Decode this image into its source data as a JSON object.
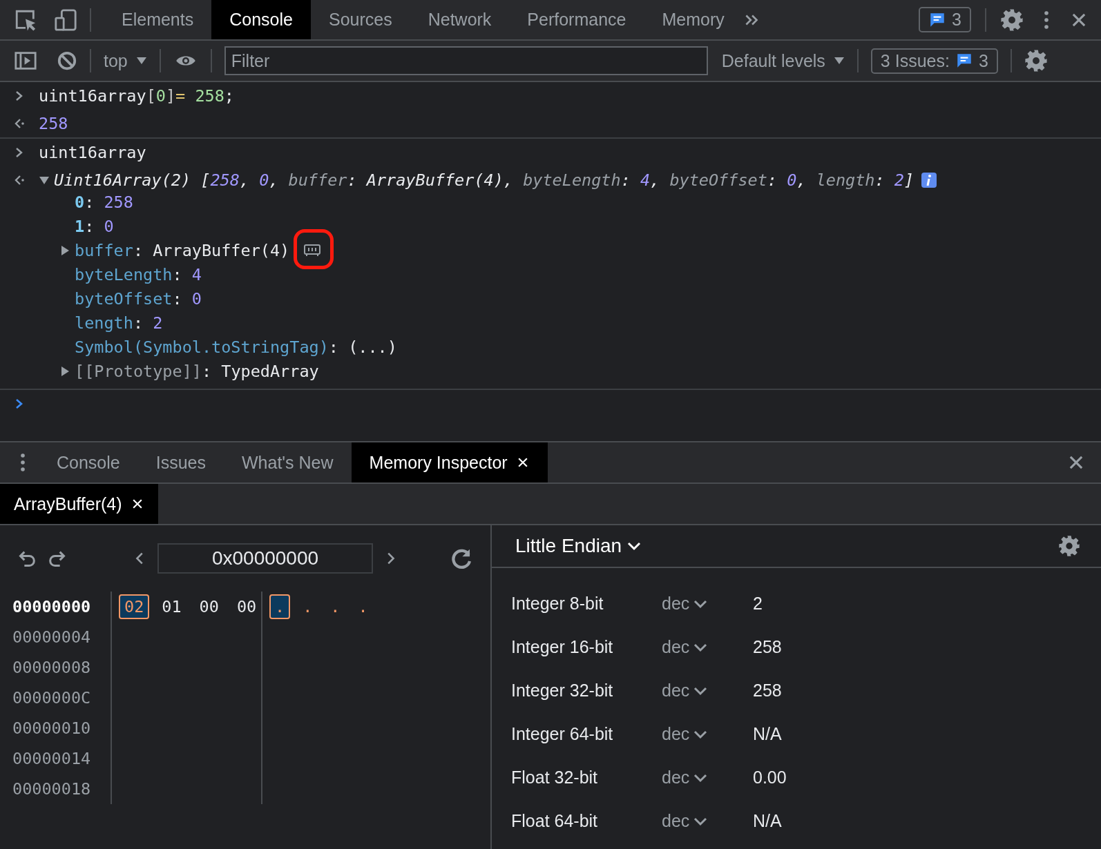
{
  "main_tabs": [
    {
      "label": "Elements",
      "selected": false
    },
    {
      "label": "Console",
      "selected": true
    },
    {
      "label": "Sources",
      "selected": false
    },
    {
      "label": "Network",
      "selected": false
    },
    {
      "label": "Performance",
      "selected": false
    },
    {
      "label": "Memory",
      "selected": false
    }
  ],
  "issues_badge": "3",
  "console_toolbar": {
    "context": "top",
    "filter_placeholder": "Filter",
    "levels": "Default levels",
    "issues_label": "3 Issues:",
    "issues_count": "3"
  },
  "console_entries": [
    {
      "kind": "input",
      "tokens": [
        {
          "text": "uint16array",
          "kind": "plain"
        },
        {
          "text": "[",
          "kind": "punct"
        },
        {
          "text": "0",
          "kind": "literal"
        },
        {
          "text": "]",
          "kind": "punct"
        },
        {
          "text": "=",
          "kind": "operator"
        },
        {
          "text": " 258",
          "kind": "literal"
        },
        {
          "text": ";",
          "kind": "plain"
        }
      ]
    },
    {
      "kind": "result",
      "tokens": [
        {
          "text": "258",
          "kind": "number"
        }
      ]
    },
    {
      "kind": "input",
      "tokens": [
        {
          "text": "uint16array",
          "kind": "plain"
        }
      ]
    },
    {
      "kind": "object",
      "expanded": true,
      "tokens": [
        {
          "text": "Uint16Array(2) [",
          "kind": "plain"
        },
        {
          "text": "258",
          "kind": "number"
        },
        {
          "text": ", ",
          "kind": "plain"
        },
        {
          "text": "0",
          "kind": "number"
        },
        {
          "text": ", ",
          "kind": "plain"
        },
        {
          "text": "buffer",
          "kind": "preview_key"
        },
        {
          "text": ": ArrayBuffer(4), ",
          "kind": "plain"
        },
        {
          "text": "byteLength",
          "kind": "preview_key"
        },
        {
          "text": ": ",
          "kind": "plain"
        },
        {
          "text": "4",
          "kind": "number"
        },
        {
          "text": ", ",
          "kind": "plain"
        },
        {
          "text": "byteOffset",
          "kind": "preview_key"
        },
        {
          "text": ": ",
          "kind": "plain"
        },
        {
          "text": "0",
          "kind": "number"
        },
        {
          "text": ", ",
          "kind": "plain"
        },
        {
          "text": "length",
          "kind": "preview_key"
        },
        {
          "text": ": ",
          "kind": "plain"
        },
        {
          "text": "2",
          "kind": "number"
        },
        {
          "text": "]",
          "kind": "plain"
        }
      ],
      "children": [
        {
          "kind": "property",
          "tokens": [
            {
              "text": "0",
              "kind": "index"
            },
            {
              "text": ": ",
              "kind": "plain"
            },
            {
              "text": "258",
              "kind": "number"
            }
          ]
        },
        {
          "kind": "property",
          "tokens": [
            {
              "text": "1",
              "kind": "index"
            },
            {
              "text": ": ",
              "kind": "plain"
            },
            {
              "text": "0",
              "kind": "number"
            }
          ]
        },
        {
          "kind": "buffer",
          "expanded": false,
          "highlighted": true,
          "tokens": [
            {
              "text": "buffer",
              "kind": "key"
            },
            {
              "text": ": ArrayBuffer(4)",
              "kind": "plain"
            }
          ]
        },
        {
          "kind": "property",
          "tokens": [
            {
              "text": "byteLength",
              "kind": "key"
            },
            {
              "text": ": ",
              "kind": "plain"
            },
            {
              "text": "4",
              "kind": "number"
            }
          ]
        },
        {
          "kind": "property",
          "tokens": [
            {
              "text": "byteOffset",
              "kind": "key"
            },
            {
              "text": ": ",
              "kind": "plain"
            },
            {
              "text": "0",
              "kind": "number"
            }
          ]
        },
        {
          "kind": "property",
          "tokens": [
            {
              "text": "length",
              "kind": "key"
            },
            {
              "text": ": ",
              "kind": "plain"
            },
            {
              "text": "2",
              "kind": "number"
            }
          ]
        },
        {
          "kind": "property",
          "tokens": [
            {
              "text": "Symbol(Symbol.toStringTag)",
              "kind": "key"
            },
            {
              "text": ": (...)",
              "kind": "plain"
            }
          ]
        },
        {
          "kind": "group",
          "expanded": false,
          "tokens": [
            {
              "text": "[[Prototype]]",
              "kind": "internal"
            },
            {
              "text": ": TypedArray",
              "kind": "plain"
            }
          ]
        }
      ]
    }
  ],
  "drawer_tabs": [
    {
      "label": "Console",
      "selected": false,
      "closable": false
    },
    {
      "label": "Issues",
      "selected": false,
      "closable": false
    },
    {
      "label": "What's New",
      "selected": false,
      "closable": false
    },
    {
      "label": "Memory Inspector",
      "selected": true,
      "closable": true
    }
  ],
  "buffer_tabs": [
    {
      "label": "ArrayBuffer(4)",
      "selected": true
    }
  ],
  "memory": {
    "address": "0x00000000",
    "rows": [
      {
        "address": "00000000",
        "selected": true,
        "bytes": [
          {
            "value": "02",
            "selected": true
          },
          {
            "value": "01",
            "selected": false
          },
          {
            "value": "00",
            "selected": false
          },
          {
            "value": "00",
            "selected": false
          }
        ],
        "chars": [
          {
            "value": ".",
            "selected": true
          },
          {
            "value": ".",
            "selected": false
          },
          {
            "value": ".",
            "selected": false
          },
          {
            "value": ".",
            "selected": false
          }
        ]
      },
      {
        "address": "00000004",
        "selected": false
      },
      {
        "address": "00000008",
        "selected": false
      },
      {
        "address": "0000000C",
        "selected": false
      },
      {
        "address": "00000010",
        "selected": false
      },
      {
        "address": "00000014",
        "selected": false
      },
      {
        "address": "00000018",
        "selected": false
      }
    ],
    "endianness": "Little Endian",
    "values": [
      {
        "label": "Integer 8-bit",
        "format": "dec",
        "value": "2"
      },
      {
        "label": "Integer 16-bit",
        "format": "dec",
        "value": "258"
      },
      {
        "label": "Integer 32-bit",
        "format": "dec",
        "value": "258"
      },
      {
        "label": "Integer 64-bit",
        "format": "dec",
        "value": "N/A"
      },
      {
        "label": "Float 32-bit",
        "format": "dec",
        "value": "0.00"
      },
      {
        "label": "Float 64-bit",
        "format": "dec",
        "value": "N/A"
      }
    ]
  }
}
